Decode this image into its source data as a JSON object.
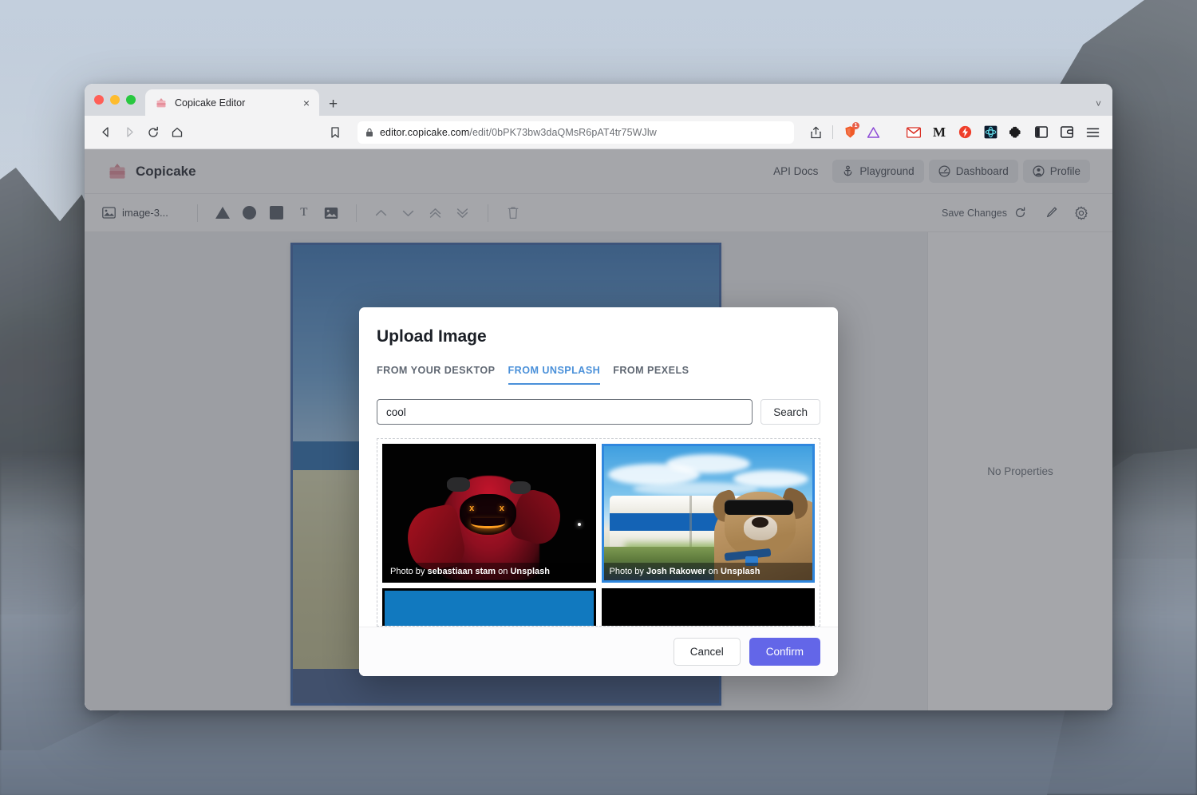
{
  "browser": {
    "tab": {
      "title": "Copicake Editor",
      "favicon": "cake-icon",
      "close": "×"
    },
    "new_tab": "+",
    "tabstrip_chevron": "˅",
    "nav": {
      "back": "back-icon",
      "forward": "forward-icon",
      "reload": "reload-icon",
      "home": "home-icon",
      "bookmark": "bookmark-icon"
    },
    "url": {
      "scheme_lock": "lock-icon",
      "host": "editor.copicake.com",
      "path": "/edit/0bPK73bw3daQMsR6pAT4tr75WJlw"
    },
    "toolbar_icons": [
      {
        "name": "share-icon",
        "glyph": "⇧"
      },
      {
        "name": "brave-shield-icon",
        "glyph": "🦁",
        "badge": "1"
      },
      {
        "name": "vercel-triangle-icon",
        "glyph": "△"
      },
      {
        "name": "gmail-icon",
        "glyph": "M"
      },
      {
        "name": "medium-icon",
        "glyph": "M"
      },
      {
        "name": "lightning-icon",
        "glyph": "⚡"
      },
      {
        "name": "grid-extension-icon",
        "glyph": "✣"
      },
      {
        "name": "extensions-puzzle-icon",
        "glyph": "✦"
      },
      {
        "name": "sidebar-panel-icon",
        "glyph": "▣"
      },
      {
        "name": "collections-icon",
        "glyph": "◰"
      },
      {
        "name": "browser-menu-icon",
        "glyph": "≡"
      }
    ]
  },
  "app": {
    "brand": "Copicake",
    "nav": [
      {
        "label": "API Docs",
        "icon": null,
        "chip": false
      },
      {
        "label": "Playground",
        "icon": "anchor-icon",
        "chip": true
      },
      {
        "label": "Dashboard",
        "icon": "dashboard-icon",
        "chip": true
      },
      {
        "label": "Profile",
        "icon": "user-icon",
        "chip": true
      }
    ],
    "toolbar": {
      "layer_name": "image-3...",
      "shapes": [
        {
          "name": "triangle-tool",
          "label": "triangle"
        },
        {
          "name": "ellipse-tool",
          "label": "circle"
        },
        {
          "name": "rect-tool",
          "label": "square"
        },
        {
          "name": "text-tool",
          "label": "T"
        },
        {
          "name": "image-tool",
          "label": "image"
        }
      ],
      "arrange": [
        {
          "name": "move-up-one",
          "glyph": "ⱏ"
        },
        {
          "name": "move-down-one",
          "glyph": "ⱟ"
        },
        {
          "name": "move-to-front",
          "glyph": "«"
        },
        {
          "name": "move-to-back",
          "glyph": "»"
        }
      ],
      "delete": "trash-icon",
      "save_label": "Save Changes",
      "save_icon": "sync-icon",
      "brush_icon": "brush-icon",
      "settings_icon": "gear-icon"
    },
    "properties_empty": "No Properties"
  },
  "modal": {
    "title": "Upload Image",
    "tabs": [
      {
        "label": "FROM YOUR DESKTOP",
        "active": false
      },
      {
        "label": "FROM UNSPLASH",
        "active": true
      },
      {
        "label": "FROM PEXELS",
        "active": false
      }
    ],
    "search": {
      "value": "cool",
      "placeholder": "",
      "button": "Search"
    },
    "results": [
      {
        "credit_prefix": "Photo by",
        "author": "sebastiaan stam",
        "credit_mid": "on",
        "source": "Unsplash",
        "selected": false,
        "art": "art1"
      },
      {
        "credit_prefix": "Photo by",
        "author": "Josh Rakower",
        "credit_mid": "on",
        "source": "Unsplash",
        "selected": true,
        "art": "art2"
      },
      {
        "credit_prefix": "",
        "author": "",
        "credit_mid": "",
        "source": "",
        "selected": false,
        "art": "art3"
      },
      {
        "credit_prefix": "",
        "author": "",
        "credit_mid": "",
        "source": "",
        "selected": false,
        "art": "art4"
      }
    ],
    "footer": {
      "cancel": "Cancel",
      "confirm": "Confirm"
    }
  },
  "colors": {
    "accent_tab": "#4a90d9",
    "confirm": "#6366e8",
    "selected_border": "#2f87de",
    "brand_pink": "#e8a3ab"
  }
}
